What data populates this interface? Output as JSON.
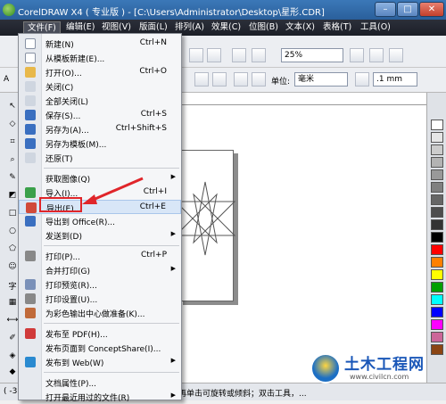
{
  "window": {
    "title": "CorelDRAW X4 ( 专业版 ) - [C:\\Users\\Administrator\\Desktop\\星形.CDR]",
    "minimize": "–",
    "restore": "□",
    "close": "✕"
  },
  "menubar": {
    "items": [
      "文件(F)",
      "编辑(E)",
      "视图(V)",
      "版面(L)",
      "排列(A)",
      "效果(C)",
      "位图(B)",
      "文本(X)",
      "表格(T)",
      "工具(O)"
    ]
  },
  "toolbar": {
    "zoom_value": "25%",
    "unit_label": "单位:",
    "unit_value": "毫米",
    "nudge_value": ".1 mm",
    "font_prefix": "A"
  },
  "file_menu": {
    "items": [
      {
        "label": "新建(N)",
        "shortcut": "Ctrl+N",
        "icon_color": "#ffffff",
        "icon": "new-document-icon"
      },
      {
        "label": "从模板新建(E)...",
        "shortcut": "",
        "icon_color": "#ffffff",
        "icon": "template-icon"
      },
      {
        "label": "打开(O)...",
        "shortcut": "Ctrl+O",
        "icon_color": "#e8b84a",
        "icon": "open-folder-icon"
      },
      {
        "label": "关闭(C)",
        "shortcut": "",
        "icon_color": "#cfd6e0",
        "icon": "close-doc-icon"
      },
      {
        "label": "全部关闭(L)",
        "shortcut": "",
        "icon_color": "#cfd6e0",
        "icon": "close-all-icon"
      },
      {
        "label": "保存(S)...",
        "shortcut": "Ctrl+S",
        "icon_color": "#3a6fc0",
        "icon": "save-icon"
      },
      {
        "label": "另存为(A)...",
        "shortcut": "Ctrl+Shift+S",
        "icon_color": "#3a6fc0",
        "icon": "save-as-icon"
      },
      {
        "label": "另存为模板(M)...",
        "shortcut": "",
        "icon_color": "#3a6fc0",
        "icon": "save-template-icon"
      },
      {
        "label": "还原(T)",
        "shortcut": "",
        "icon_color": "#cfd6e0",
        "icon": "revert-icon"
      },
      {
        "label": "获取图像(Q)",
        "shortcut": "",
        "icon_color": "",
        "icon": "",
        "submenu": true
      },
      {
        "label": "导入(I)...",
        "shortcut": "Ctrl+I",
        "icon_color": "#3aa04a",
        "icon": "import-icon"
      },
      {
        "label": "导出(E)...",
        "shortcut": "Ctrl+E",
        "icon_color": "#d04a3a",
        "icon": "export-icon"
      },
      {
        "label": "导出到 Office(R)...",
        "shortcut": "",
        "icon_color": "#3a6fc0",
        "icon": "export-office-icon"
      },
      {
        "label": "发送到(D)",
        "shortcut": "",
        "icon_color": "",
        "icon": "",
        "submenu": true
      },
      {
        "label": "打印(P)...",
        "shortcut": "Ctrl+P",
        "icon_color": "#888888",
        "icon": "print-icon"
      },
      {
        "label": "合并打印(G)",
        "shortcut": "",
        "icon_color": "",
        "icon": "",
        "submenu": true
      },
      {
        "label": "打印预览(R)...",
        "shortcut": "",
        "icon_color": "#7a90b8",
        "icon": "print-preview-icon"
      },
      {
        "label": "打印设置(U)...",
        "shortcut": "",
        "icon_color": "#888888",
        "icon": "print-setup-icon"
      },
      {
        "label": "为彩色输出中心做准备(K)...",
        "shortcut": "",
        "icon_color": "#c06a3a",
        "icon": "prepare-output-icon"
      },
      {
        "label": "发布至 PDF(H)...",
        "shortcut": "",
        "icon_color": "#d03a3a",
        "icon": "pdf-icon"
      },
      {
        "label": "发布页面到 ConceptShare(I)...",
        "shortcut": "",
        "icon_color": "",
        "icon": ""
      },
      {
        "label": "发布到 Web(W)",
        "shortcut": "",
        "icon_color": "#2a8ad0",
        "icon": "web-icon",
        "submenu": true
      },
      {
        "label": "文档属性(P)...",
        "shortcut": "",
        "icon_color": "",
        "icon": ""
      },
      {
        "label": "打开最近用过的文件(R)",
        "shortcut": "",
        "icon_color": "",
        "icon": "",
        "submenu": true
      }
    ]
  },
  "status": {
    "coords": "( -3.",
    "hint": "再单击可旋转或倾斜；双击工具，..."
  },
  "watermark": {
    "brand": "土木工程网",
    "url": "www.civilcn.com"
  },
  "colors": {
    "highlight_box": "#e0252a",
    "annotation_arrow": "#e0252a",
    "menubar_bg": "#22252e"
  }
}
